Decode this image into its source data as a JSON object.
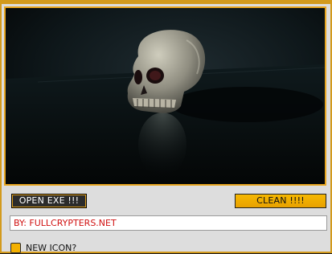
{
  "buttons": {
    "open_exe_label": "OPEN EXE !!!",
    "clean_label": "CLEAN !!!!"
  },
  "credit_field": {
    "value": "BY: FULLCRYPTERS.NET"
  },
  "new_icon_option": {
    "label": "NEW ICON?",
    "checked": false
  },
  "colors": {
    "accent": "#e7a51f",
    "credit_text": "#d01010",
    "window_bg": "#dddddd"
  },
  "banner": {
    "icon": "skull-image"
  }
}
